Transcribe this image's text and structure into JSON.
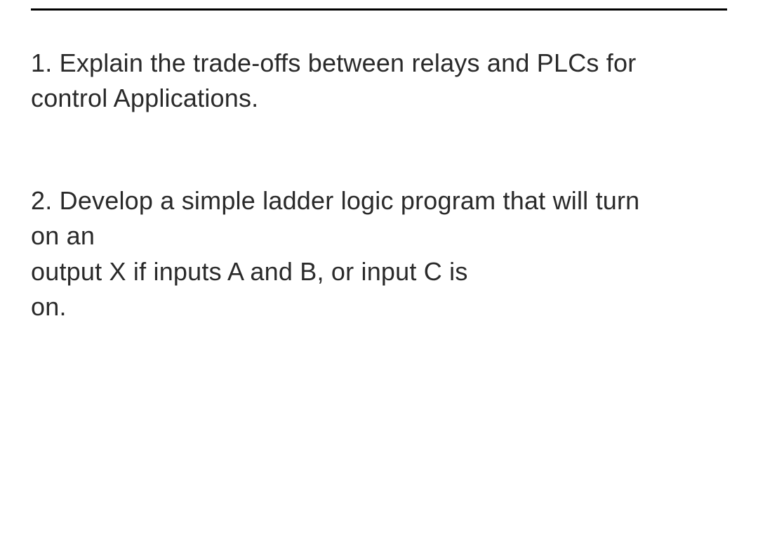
{
  "questions": {
    "q1": {
      "line1": "1. Explain the trade-offs between relays and PLCs for",
      "line2": "control Applications."
    },
    "q2": {
      "line1": "2. Develop a simple ladder logic program that will turn",
      "line2": "on an",
      "line3": "output X if inputs A and B, or input  C is",
      "line4": "on."
    }
  }
}
